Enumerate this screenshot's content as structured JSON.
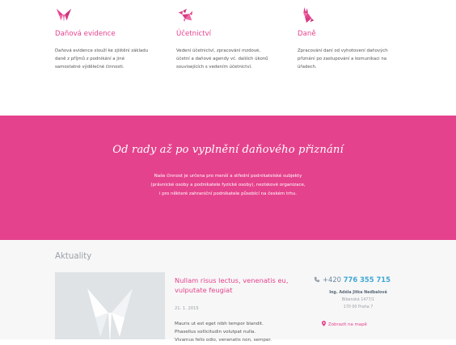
{
  "services": [
    {
      "icon": "origami-butterfly-icon",
      "title": "Daňová evidence",
      "lines": [
        "Daňová evidence slouží ke zjištění základu",
        "daně z příjmů z podnikání a jiné",
        "samostatné výdělečné činnosti."
      ]
    },
    {
      "icon": "origami-bird-icon",
      "title": "Účetnictví",
      "lines": [
        "Vedení účetnictví, zpracování mzdové,",
        "účetní a daňové agendy vč. dalších úkonů",
        "souvisejících s vedením účetnictví."
      ]
    },
    {
      "icon": "origami-rabbit-icon",
      "title": "Daně",
      "lines": [
        "Zpracování daní od vyhotovení daňových",
        "přiznání po zastupování a komunikaci na",
        "úřadech."
      ]
    }
  ],
  "banner": {
    "heading": "Od rady až po vyplnění daňového přiznání",
    "lines": [
      "Naše činnost je určena pro menší a střední podnikatelské subjekty",
      "(právnické osoby a podnikatele fyzické osoby), neziskové organizace,",
      "i pro některé zahraniční podnikatele působící na českém trhu."
    ]
  },
  "news": {
    "title": "Aktuality",
    "thumb_icon": "origami-butterfly-icon",
    "article": {
      "heading_lines": [
        "Nullam risus lectus, venenatis eu,",
        "vulputate feugiat"
      ],
      "date": "21. 1. 2015",
      "body_lines": [
        "Mauris ut est eget nibh tempor blandit.",
        "Phasellus sollicitudin volutpat nulla.",
        "Vivamus felis odio, venenatis non, semper."
      ]
    }
  },
  "contact": {
    "phone_prefix": "+420",
    "phone_number": "776 355 715",
    "name": "Ing. Adéla Jitka Nedbalová",
    "street": "Bibenská 1477/1",
    "city": "170 00 Praha 7",
    "map_link": "Zobrazit na mapě"
  },
  "colors": {
    "accent": "#e5428d",
    "phone": "#3fa7d6"
  }
}
